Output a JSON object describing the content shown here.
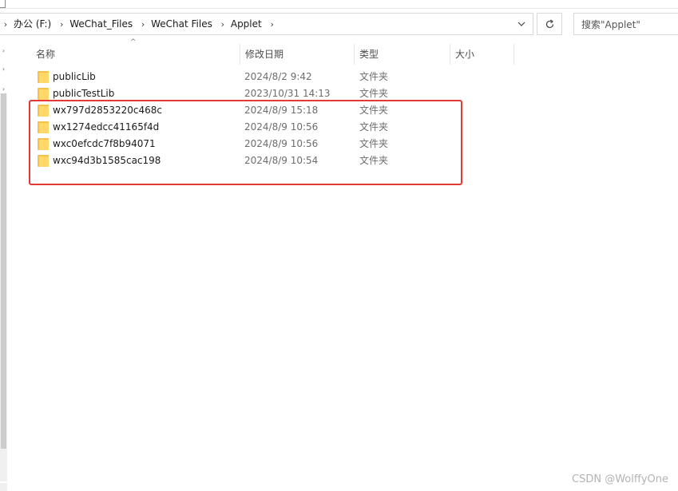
{
  "address_bar": {
    "breadcrumbs": [
      "办公 (F:)",
      "WeChat_Files",
      "WeChat Files",
      "Applet"
    ],
    "dropdown_icon": "chevron-down-icon",
    "refresh_icon": "refresh-icon"
  },
  "search": {
    "placeholder": "搜索\"Applet\""
  },
  "columns": {
    "name": "名称",
    "date": "修改日期",
    "type": "类型",
    "size": "大小"
  },
  "files": [
    {
      "name": "publicLib",
      "date": "2024/8/2 9:42",
      "type": "文件夹",
      "icon": "folder-icon"
    },
    {
      "name": "publicTestLib",
      "date": "2023/10/31 14:13",
      "type": "文件夹",
      "icon": "folder-icon"
    },
    {
      "name": "wx797d2853220c468c",
      "date": "2024/8/9 15:18",
      "type": "文件夹",
      "icon": "folder-icon"
    },
    {
      "name": "wx1274edcc41165f4d",
      "date": "2024/8/9 10:56",
      "type": "文件夹",
      "icon": "folder-icon"
    },
    {
      "name": "wxc0efcdc7f8b94071",
      "date": "2024/8/9 10:56",
      "type": "文件夹",
      "icon": "folder-icon"
    },
    {
      "name": "wxc94d3b1585cac198",
      "date": "2024/8/9 10:54",
      "type": "文件夹",
      "icon": "folder-icon"
    }
  ],
  "highlight_color": "#e53935",
  "watermark": "CSDN @WolffyOne"
}
